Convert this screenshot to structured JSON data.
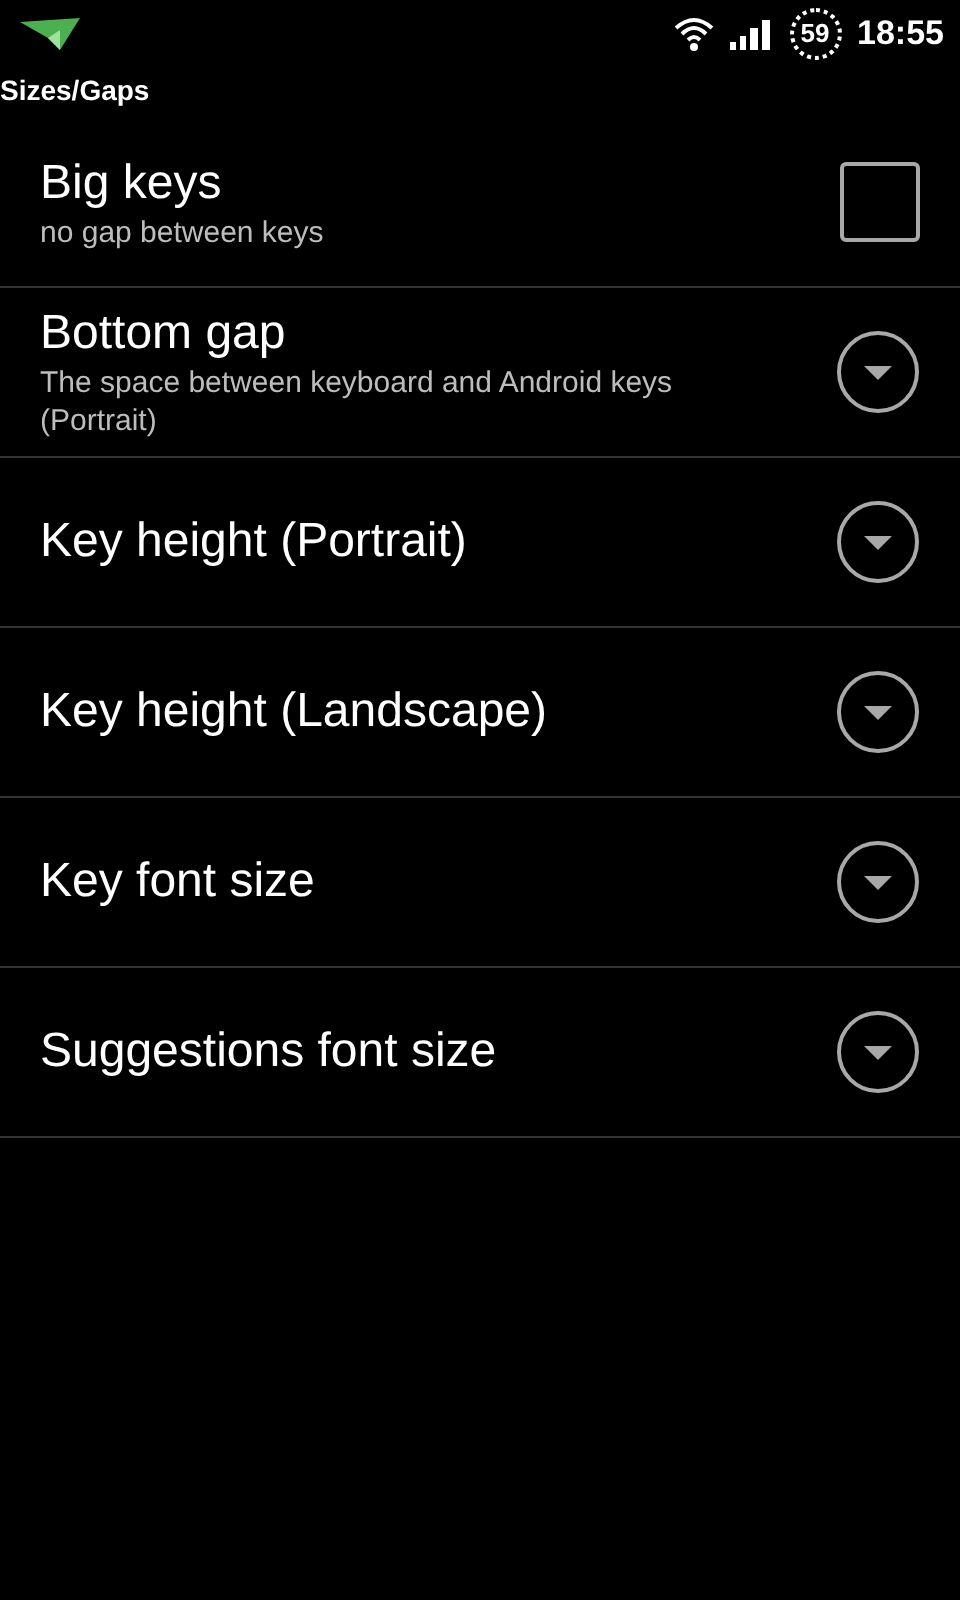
{
  "status_bar": {
    "battery": "59",
    "time": "18:55"
  },
  "header": {
    "title": "Sizes/Gaps"
  },
  "items": [
    {
      "kind": "checkbox",
      "title": "Big keys",
      "summary": "no gap between keys",
      "checked": false
    },
    {
      "kind": "dropdown",
      "title": "Bottom gap",
      "summary": "The space between keyboard and Android keys (Portrait)"
    },
    {
      "kind": "dropdown",
      "title": "Key height (Portrait)"
    },
    {
      "kind": "dropdown",
      "title": "Key height (Landscape)"
    },
    {
      "kind": "dropdown",
      "title": "Key font size"
    },
    {
      "kind": "dropdown",
      "title": "Suggestions font size"
    }
  ]
}
